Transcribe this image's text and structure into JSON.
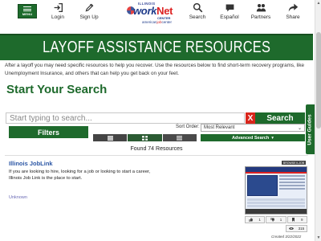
{
  "nav": {
    "menu_label": "MENU",
    "items": [
      {
        "label": "Login",
        "icon": "login-icon"
      },
      {
        "label": "Sign Up",
        "icon": "sign-up-icon"
      },
      {
        "label": "Search",
        "icon": "search-icon"
      },
      {
        "label": "Español",
        "icon": "speech-bubble-icon"
      },
      {
        "label": "Partners",
        "icon": "partners-icon"
      },
      {
        "label": "Share",
        "icon": "share-icon"
      }
    ],
    "logo": {
      "state": "ILLINOIS",
      "brand_work": "work",
      "brand_net": "Net",
      "center": "CENTER",
      "tagline_a": "american",
      "tagline_b": "job",
      "tagline_c": "center"
    }
  },
  "banner": {
    "title": "LAYOFF ASSISTANCE RESOURCES"
  },
  "intro_text": "After a layoff you may need specific resources to help you recover. Use the resources below to find short-term recovery programs, like Unemployment Insurance, and others that can help you get back on your feet.",
  "search": {
    "heading": "Start Your Search",
    "placeholder": "Start typing to search...",
    "clear_label": "X",
    "button_label": "Search",
    "filters_label": "Filters",
    "sort_label": "Sort Order:",
    "sort_value": "Most Relevant",
    "advanced_label": "Advanced Search"
  },
  "results": {
    "found_text": "Found 74 Resources",
    "items": [
      {
        "title": "Illinois JobLink",
        "description": "If you are looking to hire, looking for a job or looking to start a career, Illinois Job Link is the place to start.",
        "category": "Unknown",
        "badge": "BROWSE ILJOB",
        "stats": {
          "likes": "1",
          "dislikes": "1",
          "bookmarks": "9",
          "views": "315"
        },
        "created": "Created 3/22/2022"
      }
    ]
  },
  "side_tab": {
    "label": "User Guides"
  },
  "colors": {
    "brand_green": "#1e6a2c",
    "clear_red": "#d9261c",
    "link_blue": "#2b56a5"
  }
}
